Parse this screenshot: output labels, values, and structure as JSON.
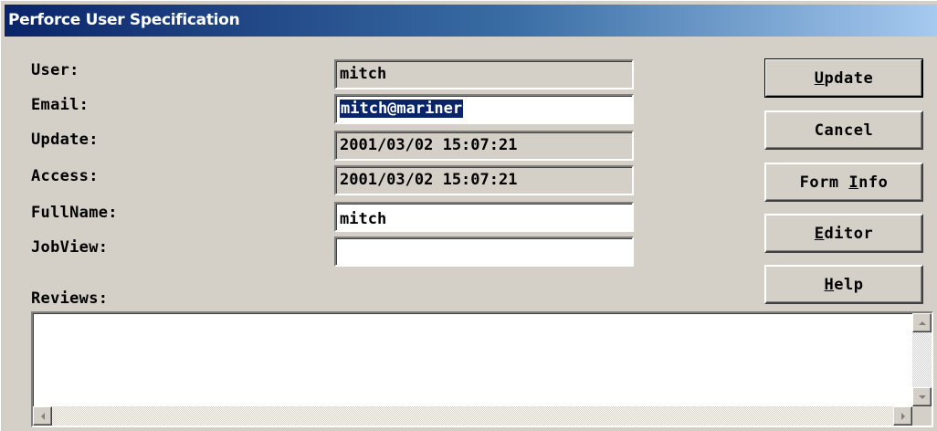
{
  "window": {
    "title": "Perforce User Specification"
  },
  "fields": [
    {
      "label": "User:",
      "value": "mitch",
      "editable": false
    },
    {
      "label": "Email:",
      "value": "mitch@mariner",
      "editable": true,
      "selected": true
    },
    {
      "label": "Update:",
      "value": "2001/03/02 15:07:21",
      "editable": false
    },
    {
      "label": "Access:",
      "value": "2001/03/02 15:07:21",
      "editable": false
    },
    {
      "label": "FullName:",
      "value": "mitch",
      "editable": true
    },
    {
      "label": "JobView:",
      "value": "",
      "editable": true
    }
  ],
  "reviews": {
    "label": "Reviews:",
    "value": ""
  },
  "buttons": [
    {
      "label": "Update",
      "mnemonic_index": 0,
      "default": true
    },
    {
      "label": "Cancel",
      "mnemonic_index": -1
    },
    {
      "label": "Form Info",
      "mnemonic_index": 5
    },
    {
      "label": "Editor",
      "mnemonic_index": 0
    },
    {
      "label": "Help",
      "mnemonic_index": 0
    }
  ],
  "icons": {
    "scroll_up": "scroll-up-arrow-icon",
    "scroll_down": "scroll-down-arrow-icon",
    "scroll_left": "scroll-left-arrow-icon",
    "scroll_right": "scroll-right-arrow-icon"
  },
  "colors": {
    "titlebar_start": "#0a246a",
    "titlebar_end": "#a6caf0",
    "face": "#d4d0c8",
    "selection": "#0a246a"
  }
}
